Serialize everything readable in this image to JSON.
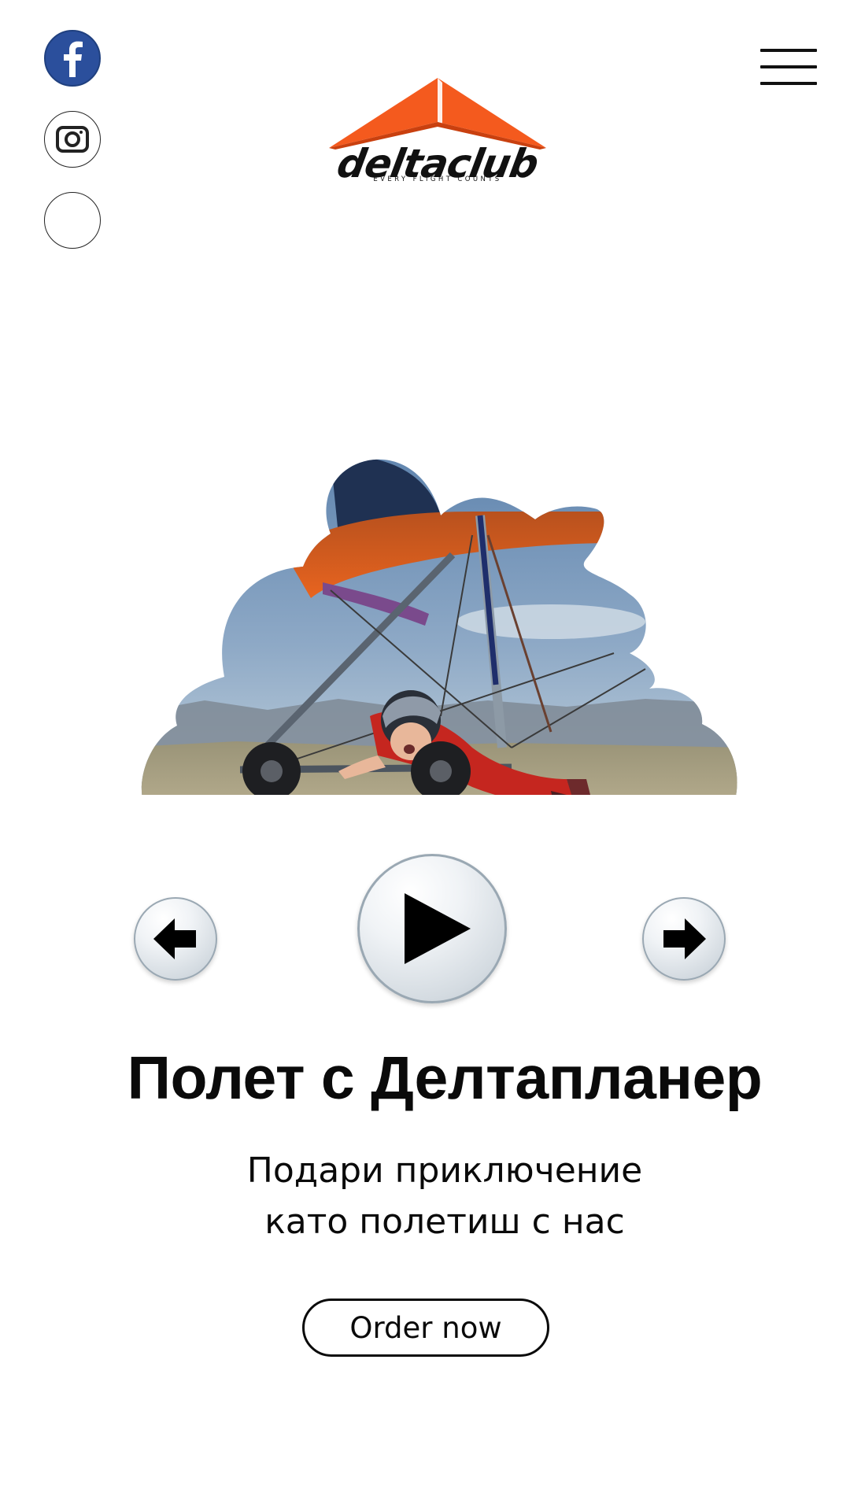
{
  "social": {
    "facebook_icon": "facebook-icon",
    "instagram_icon": "instagram-icon",
    "third_icon": "blank-circle-icon"
  },
  "header": {
    "menu_icon": "hamburger-menu-icon",
    "logo": {
      "wordmark": "deltaclub",
      "tagline": "EVERY FLIGHT COUNTS"
    }
  },
  "hero": {
    "image_description_icon": "hang-glider-photo"
  },
  "slider": {
    "prev_icon": "arrow-left-icon",
    "play_icon": "play-icon",
    "next_icon": "arrow-right-icon"
  },
  "main": {
    "title": "Полет с Делтапланер",
    "subtitle_line1": "Подари приключение",
    "subtitle_line2": "като полетиш с нас",
    "cta_label": "Order now"
  },
  "colors": {
    "facebook": "#2b4f9c",
    "logo_orange": "#f45a1e",
    "text": "#0a0a0a",
    "button_silver": "#d4dbe1"
  }
}
